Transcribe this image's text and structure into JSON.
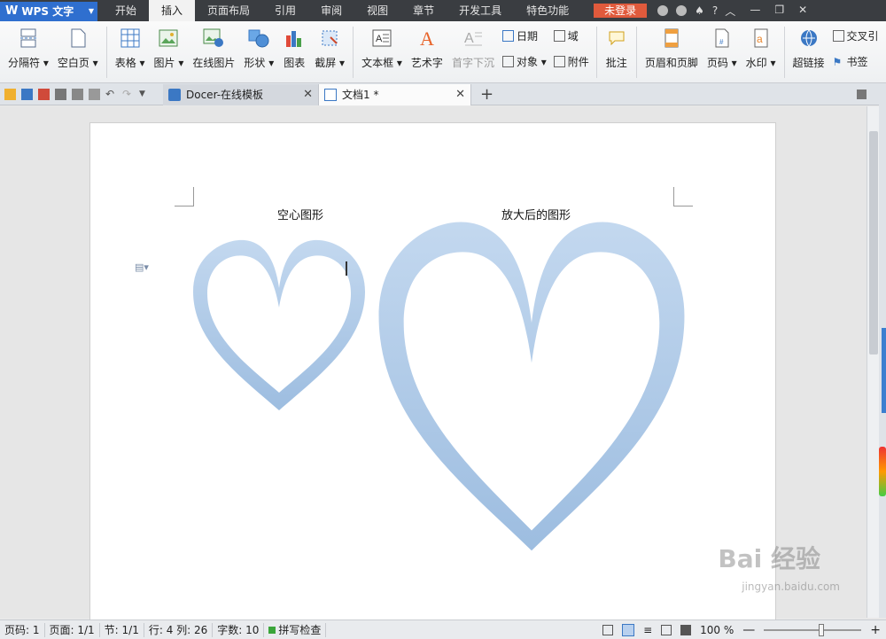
{
  "titlebar": {
    "app_name": "WPS 文字",
    "tabs": [
      "开始",
      "插入",
      "页面布局",
      "引用",
      "审阅",
      "视图",
      "章节",
      "开发工具",
      "特色功能"
    ],
    "active_tab": "插入",
    "login": "未登录",
    "help": "?"
  },
  "ribbon": {
    "items": [
      {
        "label": "分隔符 ▾",
        "icon": "page-break-icon"
      },
      {
        "label": "空白页 ▾",
        "icon": "blank-page-icon"
      },
      {
        "label": "表格 ▾",
        "icon": "table-icon"
      },
      {
        "label": "图片 ▾",
        "icon": "picture-icon"
      },
      {
        "label": "在线图片",
        "icon": "online-picture-icon"
      },
      {
        "label": "形状 ▾",
        "icon": "shapes-icon"
      },
      {
        "label": "图表",
        "icon": "chart-icon"
      },
      {
        "label": "截屏 ▾",
        "icon": "screenshot-icon"
      },
      {
        "label": "文本框 ▾",
        "icon": "textbox-icon"
      },
      {
        "label": "艺术字",
        "icon": "wordart-icon"
      },
      {
        "label": "首字下沉",
        "icon": "dropcap-icon"
      },
      {
        "label": "批注",
        "icon": "comment-icon"
      },
      {
        "label": "页眉和页脚",
        "icon": "header-footer-icon"
      },
      {
        "label": "页码 ▾",
        "icon": "page-number-icon"
      },
      {
        "label": "水印 ▾",
        "icon": "watermark-icon"
      },
      {
        "label": "超链接",
        "icon": "hyperlink-icon"
      }
    ],
    "small": {
      "date": "日期",
      "field": "域",
      "object": "对象 ▾",
      "attachment": "附件",
      "crossref": "交叉引",
      "bookmark": "书签"
    }
  },
  "tabs": {
    "docer": "Docer-在线模板",
    "doc1": "文档1 *",
    "close": "✕",
    "add": "+"
  },
  "document": {
    "caption_left": "空心图形",
    "caption_right": "放大后的图形",
    "heart_color": "#a9c6e6"
  },
  "statusbar": {
    "page_code": "页码: 1",
    "page": "页面: 1/1",
    "section": "节: 1/1",
    "row_col": "行: 4  列: 26",
    "words": "字数: 10",
    "spell": "拼写检查",
    "zoom": "100 %",
    "zoom_level": 0.6
  },
  "watermark": {
    "brand": "Bai 经验",
    "url": "jingyan.baidu.com"
  }
}
